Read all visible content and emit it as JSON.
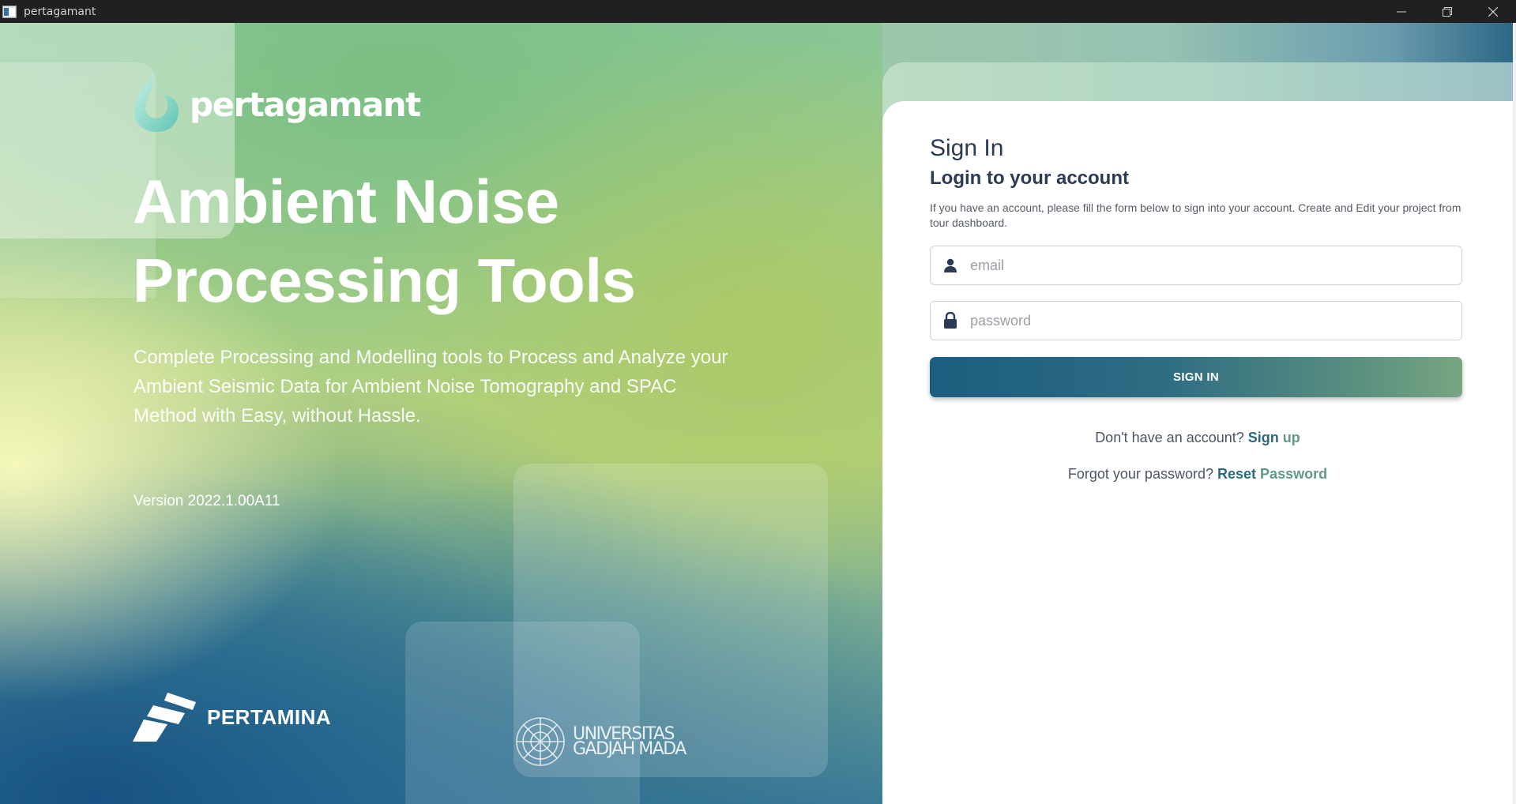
{
  "window": {
    "title": "pertagamant"
  },
  "hero": {
    "logo_text": "pertagamant",
    "headline_line1": "Ambient Noise",
    "headline_line2": "Processing Tools",
    "subline_line1": "Complete Processing and Modelling tools to Process and Analyze your",
    "subline_line2": "Ambient Seismic Data for Ambient Noise Tomography and SPAC",
    "subline_line3": "Method with Easy, without Hassle.",
    "version": "Version 2022.1.00A11",
    "partner1": "PERTAMINA",
    "partner2_line1": "UNIVERSITAS",
    "partner2_line2": "GADJAH MADA"
  },
  "form": {
    "title": "Sign In",
    "subtitle": "Login to your account",
    "description": "If you have an account, please fill the form below to sign into your account. Create and Edit your project from tour dashboard.",
    "email_placeholder": "email",
    "password_placeholder": "password",
    "signin_label": "SIGN IN",
    "signup_prompt": "Don't have an account?",
    "signup_link_a": "Sign",
    "signup_link_b": "up",
    "reset_prompt": "Forgot your password?",
    "reset_link_a": "Reset",
    "reset_link_b": "Password"
  },
  "icons": {
    "app": "app-window-icon",
    "minimize": "minimize-icon",
    "restore": "restore-icon",
    "close": "close-icon",
    "email": "user-icon",
    "password": "lock-icon"
  },
  "colors": {
    "accent": "#1b5d7f",
    "accent_end": "#78a681",
    "text_dark": "#2b3a55"
  }
}
